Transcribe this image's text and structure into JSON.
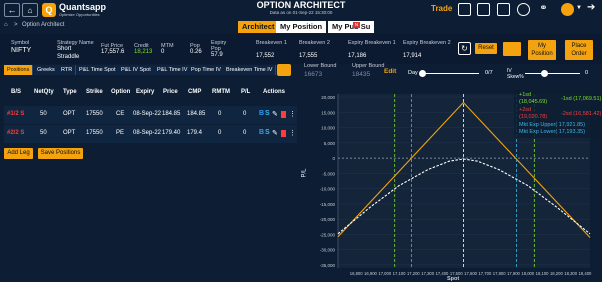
{
  "header": {
    "back_icon": "back-arrow-icon",
    "home_icon": "home-icon",
    "breadcrumb_sep": ">",
    "breadcrumb": "Option Architect",
    "logo_title": "Quantsapp",
    "logo_sub": "Optimize Opportunities",
    "title": "OPTION ARCHITECT",
    "subtitle": "Data as on 01-Sep-22 15:30:00",
    "trade_label": "Trade"
  },
  "top_tabs": [
    "Architect",
    "My Position",
    "My Pub Su"
  ],
  "top_tab_badge": "N",
  "summary": {
    "symbol_label": "Symbol",
    "symbol": "NIFTY",
    "strategy_label": "Strategy Name",
    "strategy": "Short Straddle",
    "fut_label": "Fut Price",
    "fut": "17,557.6",
    "credit_label": "Credit",
    "credit": "18,213",
    "mtm_label": "MTM",
    "mtm": "0",
    "pop_label": "Pop",
    "pop": "0.26",
    "exp_pop_label": "Expiry Pop",
    "exp_pop": "57.9",
    "be1_label": "Breakeven 1",
    "be1": "17,552",
    "be2_label": "Breakeven 2",
    "be2": "17,555",
    "exbe1_label": "Expiry Breakeven 1",
    "exbe1": "17,186",
    "exbe2_label": "Expiry Breakeven 2",
    "exbe2": "17,914",
    "reset": "Reset",
    "my_position": "My Position",
    "place_order": "Place Order"
  },
  "grid_tabs": [
    "Positions",
    "Greeks",
    "RTR",
    "P&L Time Spot",
    "P&L IV Spot",
    "P&L Time IV",
    "Pop Time IV",
    "Breakeven Time IV"
  ],
  "table": {
    "headers": [
      "B/S",
      "NetQty",
      "Type",
      "Strike",
      "Option",
      "Expiry",
      "Price",
      "CMP",
      "RMTM",
      "P/L",
      "Actions"
    ],
    "rows": [
      {
        "bs": "#1/2 S",
        "qty": "50",
        "type": "OPT",
        "strike": "17550",
        "option": "CE",
        "expiry": "08-Sep-22",
        "price": "184.85",
        "cmp": "184.85",
        "rmtm": "0",
        "pl": "0"
      },
      {
        "bs": "#2/2 S",
        "qty": "50",
        "type": "OPT",
        "strike": "17550",
        "option": "PE",
        "expiry": "08-Sep-22",
        "price": "179.40",
        "cmp": "179.4",
        "rmtm": "0",
        "pl": "0"
      }
    ]
  },
  "buttons": {
    "add_leg": "Add Leg",
    "save": "Save Positions"
  },
  "bounds": {
    "lower_label": "Lower Bound",
    "lower": "16673",
    "upper_label": "Upper Bound",
    "upper": "18435",
    "edit": "Edit"
  },
  "sliders": {
    "day_label": "Day",
    "day_value": "0/7",
    "iv_label": "IV Skew%",
    "iv_value": "0"
  },
  "chart_data": {
    "type": "line",
    "ylabel": "P/L",
    "xlabel": "Spot",
    "x_ticks": [
      "16,800",
      "16,900",
      "17,000",
      "17,100",
      "17,200",
      "17,300",
      "17,400",
      "17,500",
      "17,600",
      "17,700",
      "17,800",
      "17,900",
      "18,000",
      "18,100",
      "18,200",
      "18,300",
      "18,400"
    ],
    "y_ticks": [
      "20,000",
      "15,000",
      "10,000",
      "5,000",
      "0",
      "-5,000",
      "-10,000",
      "-15,000",
      "-20,000",
      "-25,000",
      "-30,000",
      "-35,000"
    ],
    "xlim": [
      16673,
      18435
    ],
    "ylim": [
      -36000,
      21000
    ],
    "series": [
      {
        "name": "Expiry",
        "color": "#f4a30f",
        "points": [
          [
            16673,
            -25750
          ],
          [
            17186,
            0
          ],
          [
            17550,
            18200
          ],
          [
            17914,
            0
          ],
          [
            18435,
            -26000
          ]
        ]
      },
      {
        "name": "T+0",
        "color": "#ffffff",
        "points": [
          [
            16673,
            -24800
          ],
          [
            16900,
            -16000
          ],
          [
            17100,
            -9000
          ],
          [
            17300,
            -3800
          ],
          [
            17450,
            -1000
          ],
          [
            17550,
            -300
          ],
          [
            17650,
            -1000
          ],
          [
            17800,
            -3800
          ],
          [
            18000,
            -9000
          ],
          [
            18200,
            -16000
          ],
          [
            18435,
            -24800
          ]
        ]
      }
    ],
    "markers": [
      {
        "x": 17069.51,
        "color": "#7ddf2d"
      },
      {
        "x": 17186,
        "color": "#3fb6e6"
      },
      {
        "x": 17550,
        "color": "#ffffff"
      },
      {
        "x": 17921.85,
        "color": "#3fb6e6"
      },
      {
        "x": 18045.69,
        "color": "#7ddf2d"
      }
    ],
    "legend": [
      {
        "text": "+1sd",
        "color": "#7ddf2d"
      },
      {
        "text": "(18,045.69)",
        "color": "#7ddf2d"
      },
      {
        "text": "-1sd (17,069.51)",
        "color": "#7ddf2d"
      },
      {
        "text": "+2sd",
        "color": "#ff3b3b"
      },
      {
        "text": "(19,020.78)",
        "color": "#ff3b3b"
      },
      {
        "text": "-2sd (16,581.42)",
        "color": "#ff3b3b"
      },
      {
        "text": "Mkt Exp Upper( 17,921.85)",
        "color": "#3fb6e6"
      },
      {
        "text": "Mkt Exp Lower( 17,193.35)",
        "color": "#3fb6e6"
      }
    ]
  }
}
